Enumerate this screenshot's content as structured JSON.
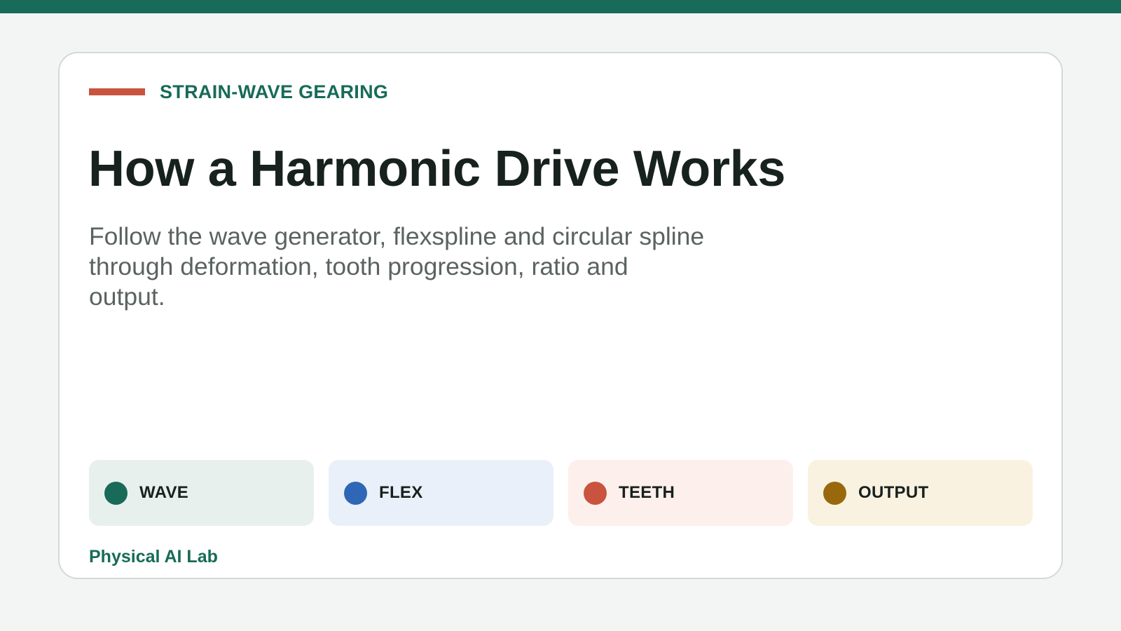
{
  "header": {
    "eyebrow": "STRAIN-WAVE GEARING",
    "title": "How a Harmonic Drive Works",
    "subtitle": "Follow the wave generator, flexspline and circular spline through deformation, tooth progression, ratio and output."
  },
  "chips": [
    {
      "label": "WAVE",
      "dot_color": "#176b58",
      "bg_color": "#e8f0ed"
    },
    {
      "label": "FLEX",
      "dot_color": "#2f67b6",
      "bg_color": "#e9f0fa"
    },
    {
      "label": "TEETH",
      "dot_color": "#c9533e",
      "bg_color": "#fdefec"
    },
    {
      "label": "OUTPUT",
      "dot_color": "#99680c",
      "bg_color": "#faf2e1"
    }
  ],
  "footer": {
    "brand": "Physical AI Lab"
  },
  "colors": {
    "accent": "#176b58",
    "rule": "#c9533e"
  }
}
